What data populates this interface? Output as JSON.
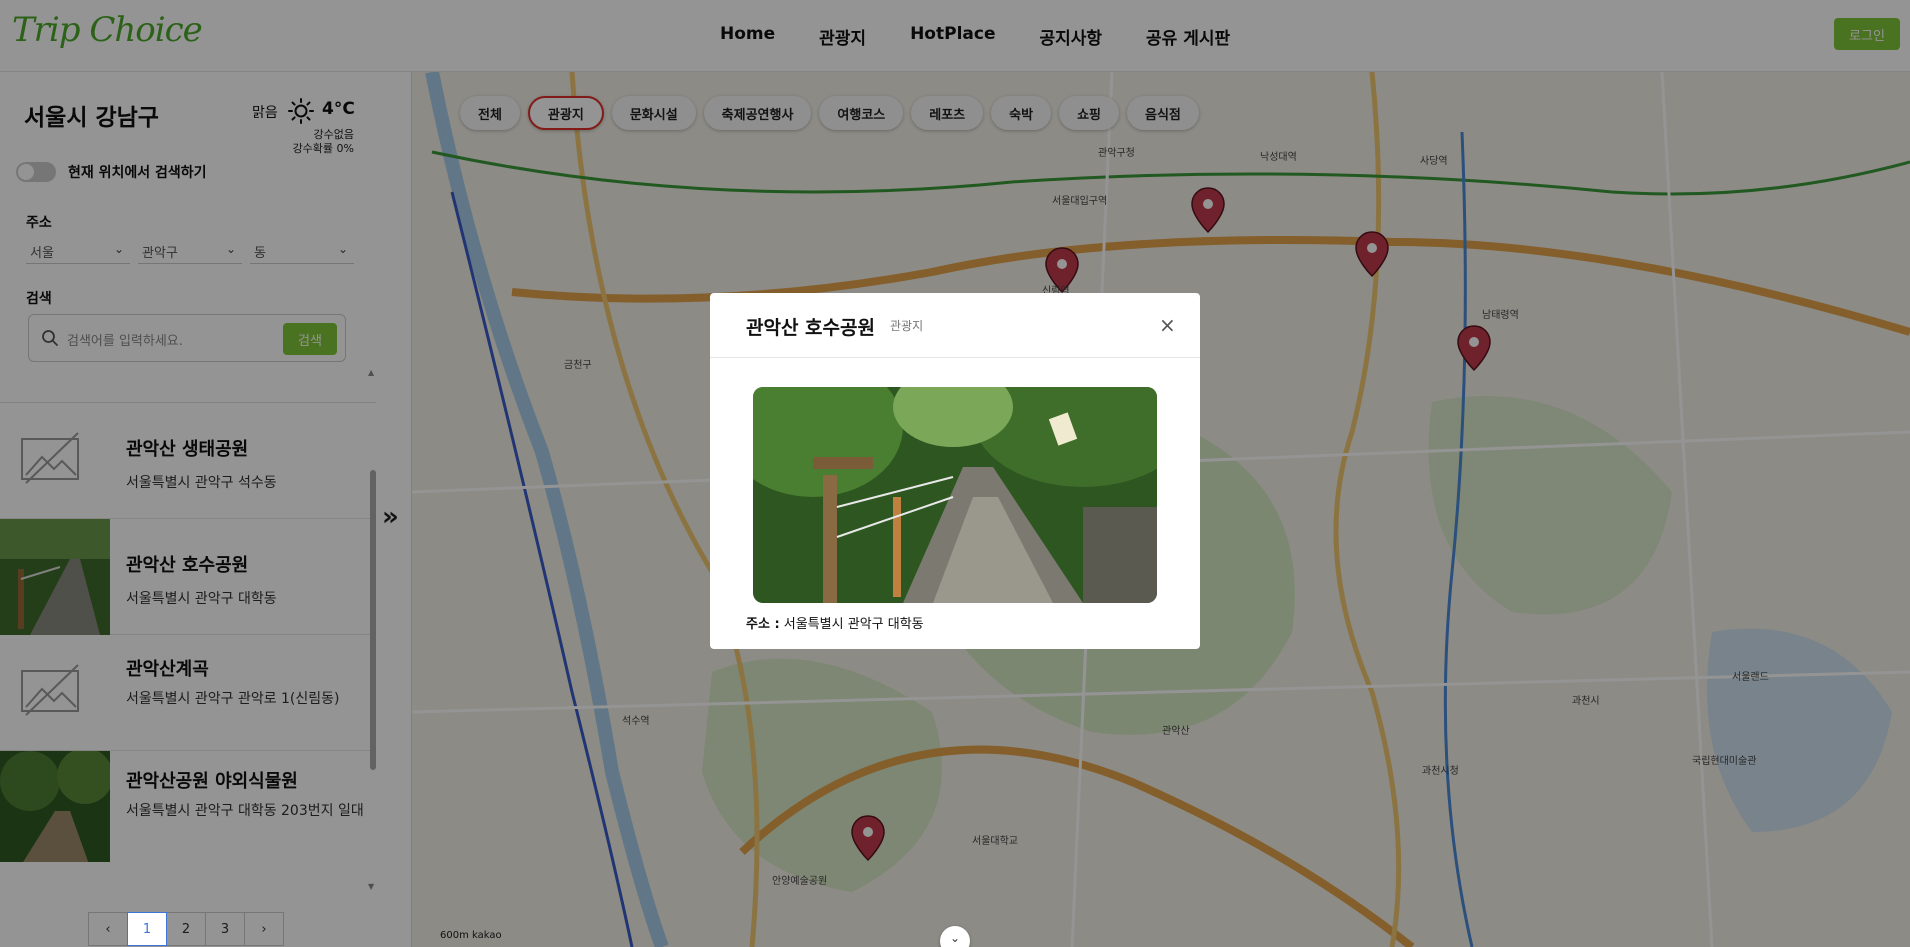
{
  "header": {
    "logo": "Trip Choice",
    "nav": [
      "Home",
      "관광지",
      "HotPlace",
      "공지사항",
      "공유 게시판"
    ],
    "login_label": "로그인"
  },
  "sidebar": {
    "region": "서울시 강남구",
    "weather": {
      "condition": "맑음",
      "temperature": "4°C",
      "precip_text": "강수없음",
      "precip_prob": "강수확률 0%",
      "icon": "sun-icon"
    },
    "toggle_label": "현재 위치에서 검색하기",
    "address_label": "주소",
    "selects": {
      "city": "서울",
      "district": "관악구",
      "dong": "동"
    },
    "search_label": "검색",
    "search_placeholder": "검색어를 입력하세요.",
    "search_button": "검색",
    "items": [
      {
        "title": "관악산 생태공원",
        "address": "서울특별시 관악구 석수동",
        "image": "none"
      },
      {
        "title": "관악산 호수공원",
        "address": "서울특별시 관악구 대학동",
        "image": "photo"
      },
      {
        "title": "관악산계곡",
        "address": "서울특별시 관악구 관악로 1(신림동)",
        "image": "none"
      },
      {
        "title": "관악산공원 야외식물원",
        "address": "서울특별시 관악구 대학동 203번지 일대",
        "image": "photo"
      }
    ],
    "no_image_text": "No Image",
    "pagination": {
      "prev": "‹",
      "pages": [
        "1",
        "2",
        "3"
      ],
      "current": "1",
      "next": "›"
    }
  },
  "map": {
    "categories": [
      "전체",
      "관광지",
      "문화시설",
      "축제공연행사",
      "여행코스",
      "레포츠",
      "숙박",
      "쇼핑",
      "음식점"
    ],
    "active_category": "관광지",
    "labels": [
      "금천구",
      "관악구청",
      "서울대입구역",
      "낙성대역",
      "사당역",
      "남태령역",
      "과천시청",
      "관악산",
      "서울대학교",
      "신림역",
      "석수역",
      "안양예술공원",
      "과천시",
      "서울랜드",
      "국립현대미술관"
    ],
    "scale": "600m",
    "attribution": "kakao"
  },
  "modal": {
    "title": "관악산 호수공원",
    "category": "관광지",
    "close": "×",
    "address_prefix": "주소 :",
    "address": "서울특별시 관악구 대학동"
  },
  "colors": {
    "brand": "#4aaa2a",
    "button": "#7fc43a",
    "active_chip_border": "#e0302a",
    "marker": "#c23b4c"
  }
}
